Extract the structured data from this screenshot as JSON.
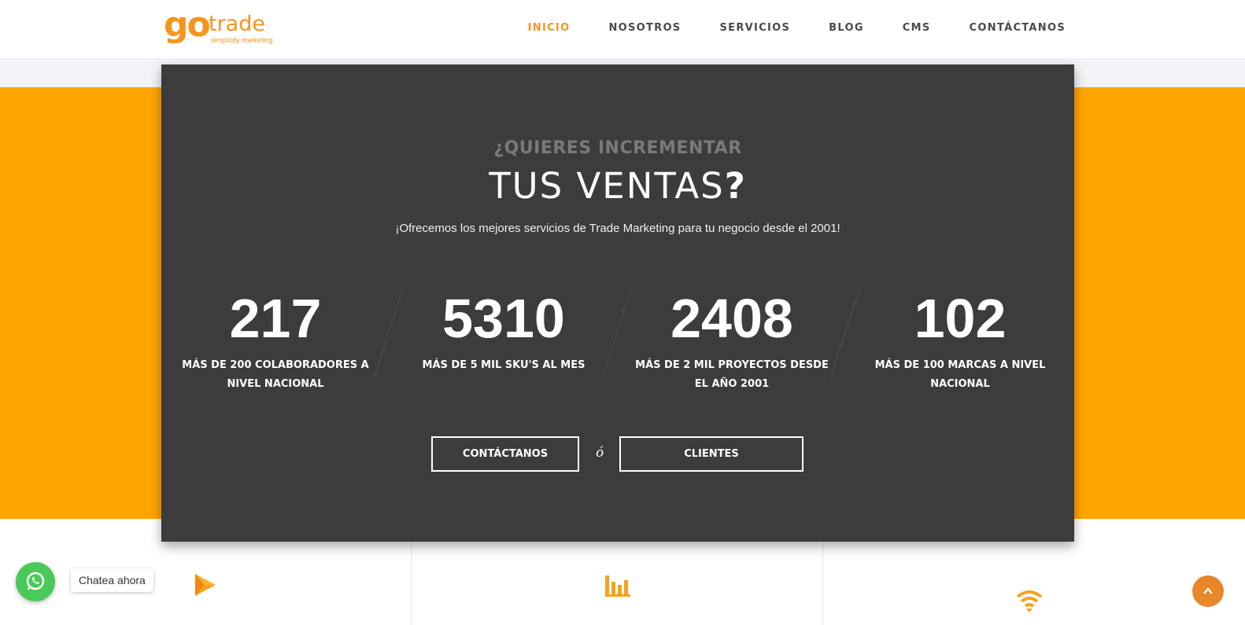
{
  "brand": {
    "logo_go": "go",
    "logo_trade": "trade",
    "logo_tagline": "simplicity marketing",
    "accent_color": "#f7941d",
    "orange_band_color": "#ffa500",
    "panel_color": "#3c3c3e"
  },
  "nav": {
    "items": [
      {
        "label": "INICIO",
        "active": true
      },
      {
        "label": "NOSOTROS",
        "active": false
      },
      {
        "label": "SERVICIOS",
        "active": false
      },
      {
        "label": "BLOG",
        "active": false
      },
      {
        "label": "CMS",
        "active": false
      },
      {
        "label": "CONTÁCTANOS",
        "active": false
      }
    ]
  },
  "hero": {
    "pre_title": "¿QUIERES INCREMENTAR",
    "title": "TUS  VENTAS",
    "title_mark": "?",
    "subtitle": "¡Ofrecemos los mejores servicios de Trade Marketing para tu negocio desde el 2001!",
    "stats": [
      {
        "number": "217",
        "label": "MÁS DE 200 COLABORADORES A NIVEL NACIONAL"
      },
      {
        "number": "5310",
        "label": "MÁS DE 5 MIL SKU'S AL MES"
      },
      {
        "number": "2408",
        "label": "MÁS DE 2 MIL PROYECTOS DESDE EL  AÑO 2001"
      },
      {
        "number": "102",
        "label": "MÁS DE 100 MARCAS A NIVEL NACIONAL"
      }
    ],
    "cta_contact": "CONTÁCTANOS",
    "cta_or": "ó",
    "cta_clients": "CLIENTES"
  },
  "features": {
    "icons": [
      "play-icon",
      "bar-chart-icon",
      "wifi-icon"
    ]
  },
  "chat": {
    "tooltip": "Chatea ahora",
    "icon": "whatsapp-icon",
    "color": "#4ac959"
  },
  "back_to_top": {
    "icon": "chevron-up-icon",
    "color": "#e8862a"
  }
}
